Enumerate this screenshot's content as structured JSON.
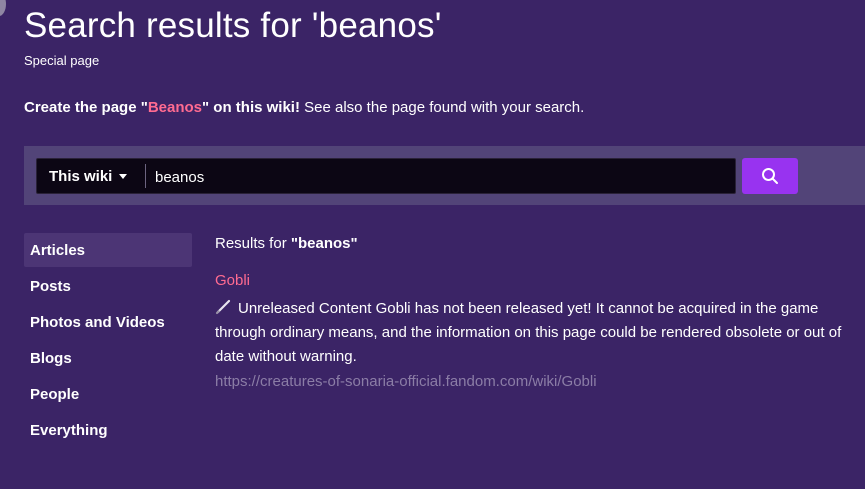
{
  "header": {
    "title": "Search results for 'beanos'",
    "subtitle": "Special page"
  },
  "create_notice": {
    "prefix": "Create the page \"",
    "page_name": "Beanos",
    "middle": "\" on this wiki!",
    "suffix": " See also the page found with your search."
  },
  "search": {
    "scope_label": "This wiki",
    "query": "beanos",
    "button_icon": "search-icon"
  },
  "filters": {
    "items": [
      {
        "label": "Articles",
        "active": true
      },
      {
        "label": "Posts",
        "active": false
      },
      {
        "label": "Photos and Videos",
        "active": false
      },
      {
        "label": "Blogs",
        "active": false
      },
      {
        "label": "People",
        "active": false
      },
      {
        "label": "Everything",
        "active": false
      }
    ]
  },
  "results": {
    "header_prefix": "Results for ",
    "header_query": "\"beanos\"",
    "items": [
      {
        "title": "Gobli",
        "icon": "pencil-icon",
        "snippet": "Unreleased Content Gobli has not been released yet! It cannot be acquired in the game through ordinary means, and the information on this page could be rendered obsolete or out of date without warning.",
        "url": "https://creatures-of-sonaria-official.fandom.com/wiki/Gobli"
      }
    ]
  },
  "colors": {
    "background": "#3b2466",
    "accent_link": "#ff6b91",
    "search_button": "#9833f0",
    "url_text": "#8b7da6"
  }
}
